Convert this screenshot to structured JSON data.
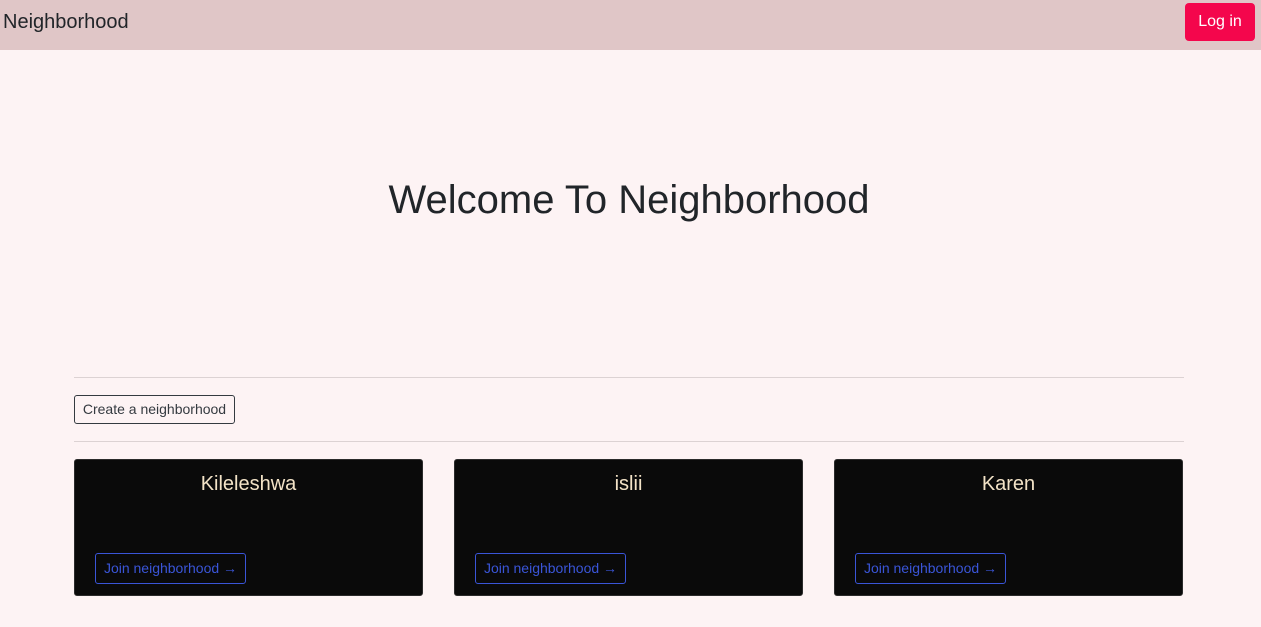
{
  "navbar": {
    "brand": "Neighborhood",
    "login_label": "Log in"
  },
  "hero": {
    "title": "Welcome To Neighborhood"
  },
  "actions": {
    "create_label": "Create a neighborhood"
  },
  "neighborhoods": [
    {
      "name": "Kileleshwa",
      "join_label": "Join neighborhood →"
    },
    {
      "name": "islii",
      "join_label": "Join neighborhood →"
    },
    {
      "name": "Karen",
      "join_label": "Join neighborhood →"
    }
  ],
  "colors": {
    "navbar_bg": "#e0c6c7",
    "page_bg": "#fdf3f4",
    "login_bg": "#f4064c",
    "card_bg": "#0a0a0a",
    "card_title": "#f3e3c7",
    "join_accent": "#3a55d8"
  }
}
